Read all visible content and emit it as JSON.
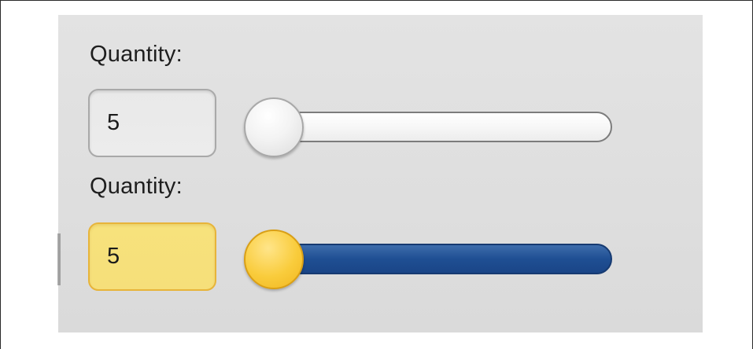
{
  "colors": {
    "panel_background": "#e0e0e0",
    "input_normal_background": "#ebebeb",
    "input_focused_background": "#f7e27c",
    "input_focused_border": "#e7b43a",
    "slider_track_normal": "#f6f6f6",
    "slider_track_active": "#1f4f93",
    "slider_thumb_normal": "#f3f3f3",
    "slider_thumb_active": "#f9cc3c"
  },
  "controls": [
    {
      "state": "normal",
      "label": "Quantity:",
      "input_value": "5",
      "slider_value": 5
    },
    {
      "state": "focused",
      "label": "Quantity:",
      "input_value": "5",
      "slider_value": 5
    }
  ]
}
